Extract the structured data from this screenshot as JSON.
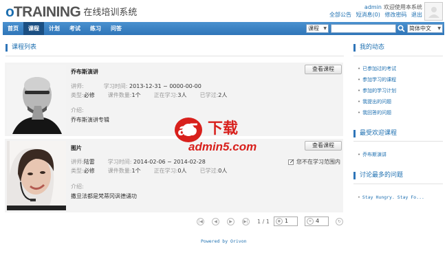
{
  "header": {
    "logo_o": "o",
    "logo_main": "TRAINING",
    "logo_sub": "在线培训系统",
    "username": "admin",
    "welcome": "欢迎使用本系统",
    "links": [
      "全部公告",
      "短消息(0)",
      "修改密码",
      "退出"
    ]
  },
  "nav": {
    "items": [
      "首页",
      "课程",
      "计划",
      "考试",
      "练习",
      "问答"
    ],
    "active_index": 1,
    "search_type": "课程",
    "search_value": "",
    "language": "简体中文"
  },
  "main": {
    "section_title": "课程列表",
    "courses": [
      {
        "title": "乔布斯演讲",
        "button": "查看课程",
        "teacher_label": "讲师:",
        "teacher": "",
        "time_label": "学习时间:",
        "time": "2013-12-31 ~ 0000-00-00",
        "type_label": "类型:",
        "type": "必修",
        "count_label": "课件数量:",
        "count": "1个",
        "learning_label": "正在学习:",
        "learning": "3人",
        "learned_label": "已学过:",
        "learned": "2人",
        "intro_label": "介绍:",
        "intro": "乔布斯演讲专辑",
        "note": ""
      },
      {
        "title": "图片",
        "button": "查看课程",
        "teacher_label": "讲师:",
        "teacher": "陆雷",
        "time_label": "学习时间:",
        "time": "2014-02-06 ~ 2014-02-28",
        "type_label": "类型:",
        "type": "必修",
        "count_label": "课件数量:",
        "count": "1个",
        "learning_label": "正在学习:",
        "learning": "0人",
        "learned_label": "已学过:",
        "learned": "0人",
        "intro_label": "介绍:",
        "intro": "撒旦法都是梵蒂冈讽德诵功",
        "note": "您不在学习范围内"
      }
    ],
    "pager": {
      "page_info": "1 / 1",
      "page_input": "1",
      "page_size": "4"
    },
    "powered": "Powered by Orivon"
  },
  "sidebar": {
    "my_activity_title": "我的动态",
    "my_activity": [
      "已参加过的考试",
      "参加学习的课程",
      "参加的学习计划",
      "我提出的问题",
      "我回答的问题"
    ],
    "popular_title": "最受欢迎课程",
    "popular": [
      "乔布斯演讲"
    ],
    "discussed_title": "讨论最多的问题",
    "discussed": [
      "Stay Hungry. Stay Fo..."
    ]
  },
  "watermark": {
    "main": "下载",
    "sub": "admin5.com",
    "a5": "a5"
  },
  "colors": {
    "accent": "#1d6fb0",
    "nav": "#2f75b8",
    "nav_active": "#1b4f82",
    "card_bg": "#f3f3f3"
  }
}
